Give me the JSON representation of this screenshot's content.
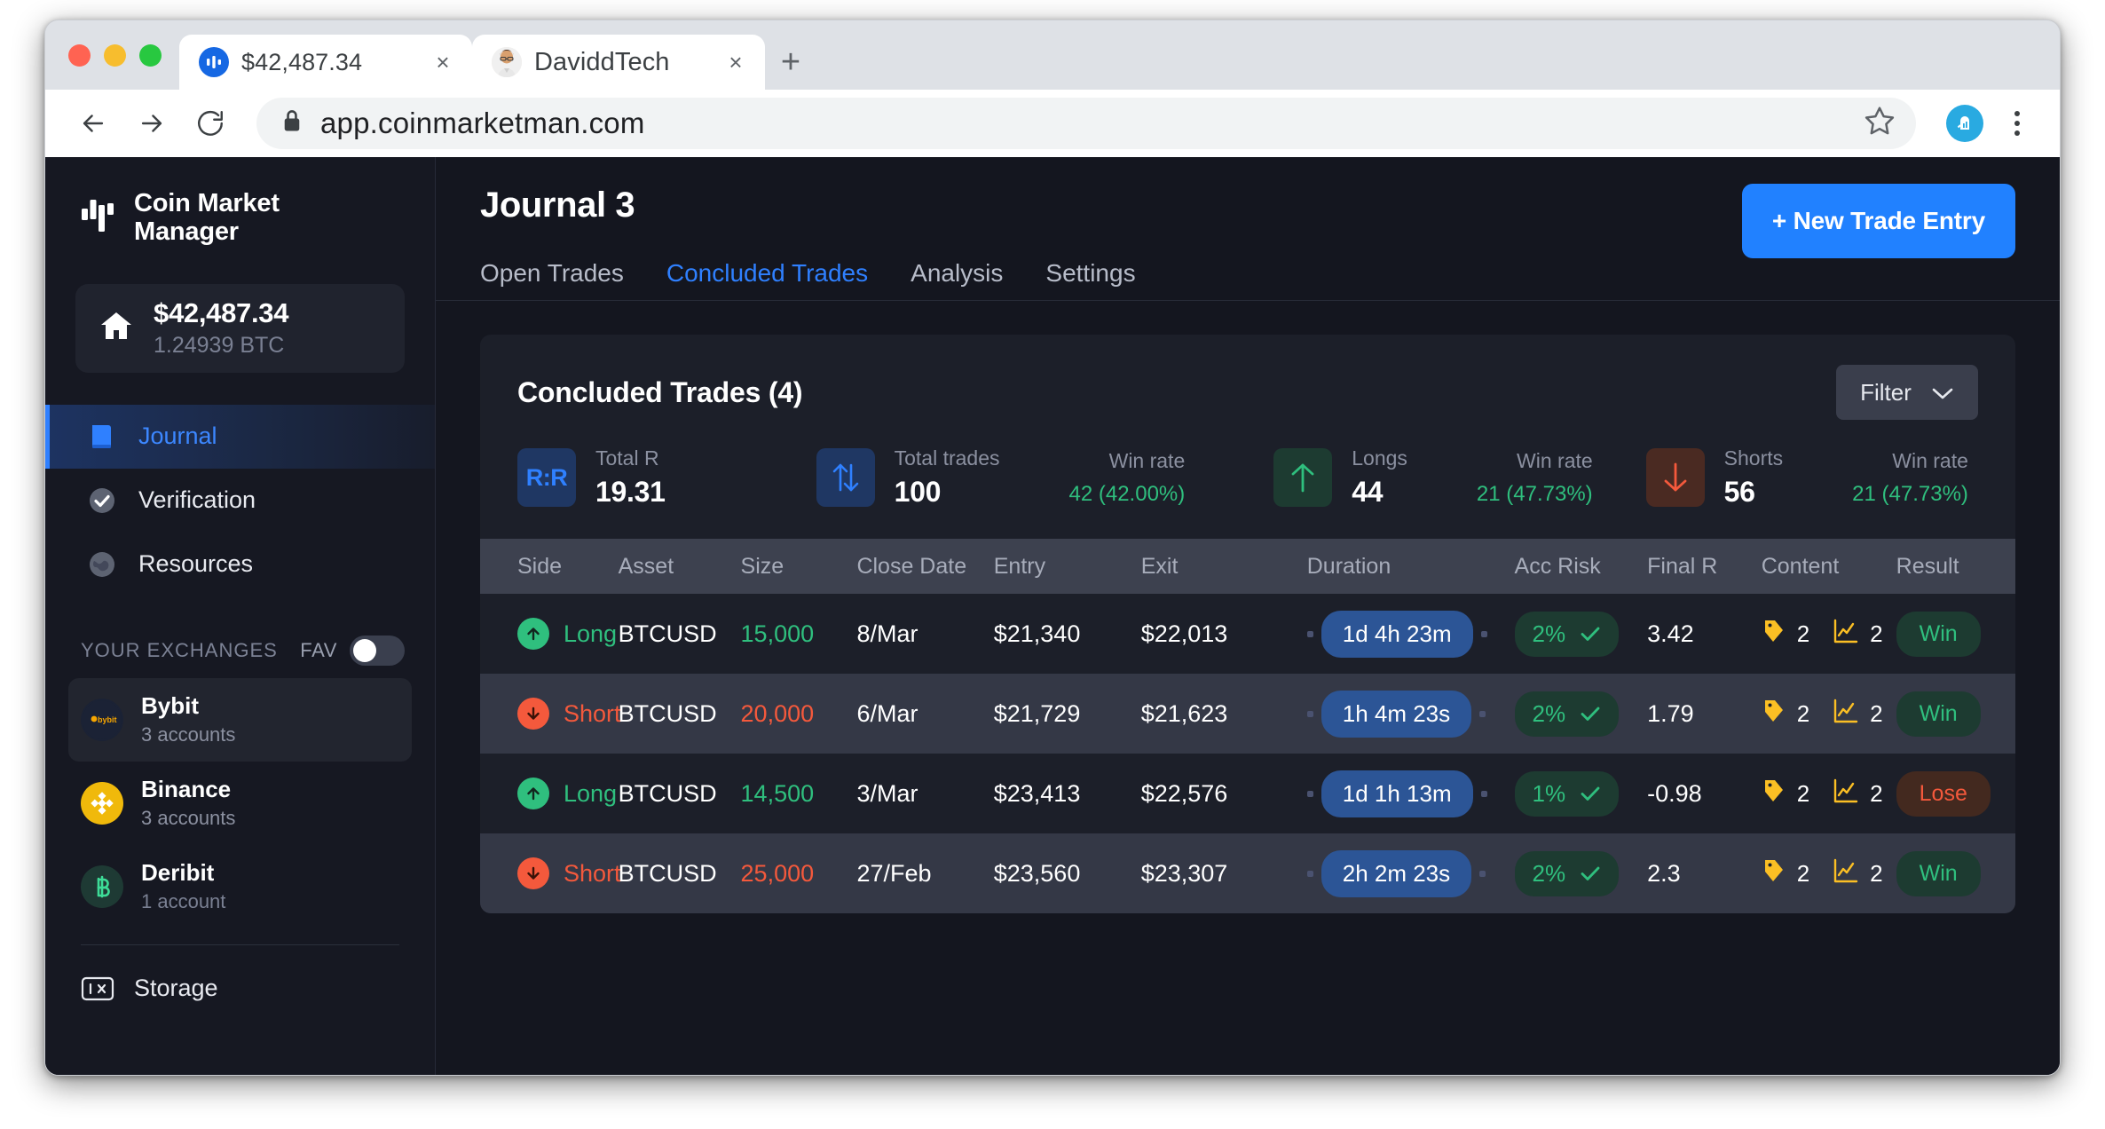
{
  "browser": {
    "tabs": [
      {
        "title": "$42,487.34",
        "favicon": "coinmarketmanager-icon",
        "active": false
      },
      {
        "title": "DaviddTech",
        "favicon": "avatar-icon",
        "active": true
      }
    ],
    "new_tab_label": "+",
    "close_label": "×",
    "url": "app.coinmarketman.com",
    "lock_icon": "lock-icon",
    "star_icon": "bookmark-star-icon",
    "extension_icon": "extension-icon",
    "menu_icon": "kebab-menu-icon",
    "back_icon": "back-arrow-icon",
    "forward_icon": "forward-arrow-icon",
    "reload_icon": "reload-icon"
  },
  "sidebar": {
    "logo": {
      "line1": "Coin Market",
      "line2": "Manager",
      "icon": "candlestick-logo-icon"
    },
    "balance": {
      "icon": "home-icon",
      "amount": "$42,487.34",
      "btc": "1.24939 BTC"
    },
    "nav": [
      {
        "label": "Journal",
        "icon": "book-icon",
        "active": true
      },
      {
        "label": "Verification",
        "icon": "check-circle-icon",
        "active": false
      },
      {
        "label": "Resources",
        "icon": "globe-icon",
        "active": false
      }
    ],
    "exchanges_header": {
      "label": "YOUR EXCHANGES",
      "fav_label": "FAV",
      "toggle_on": false
    },
    "exchanges": [
      {
        "name": "Bybit",
        "accounts": "3 accounts",
        "icon": "bybit-icon",
        "selected": true
      },
      {
        "name": "Binance",
        "accounts": "3 accounts",
        "icon": "binance-icon",
        "selected": false
      },
      {
        "name": "Deribit",
        "accounts": "1 account",
        "icon": "deribit-icon",
        "selected": false
      }
    ],
    "storage": {
      "label": "Storage",
      "icon": "storage-icon"
    }
  },
  "main": {
    "page_title": "Journal 3",
    "tabs": [
      {
        "label": "Open Trades",
        "active": false
      },
      {
        "label": "Concluded Trades",
        "active": true
      },
      {
        "label": "Analysis",
        "active": false
      },
      {
        "label": "Settings",
        "active": false
      }
    ],
    "new_trade_button": "+ New Trade Entry",
    "card_title": "Concluded Trades (4)",
    "filter_button": {
      "label": "Filter",
      "icon": "chevron-down-icon"
    },
    "stats": [
      {
        "icon": "rr-icon",
        "icon_text": "R:R",
        "label": "Total R",
        "value": "19.31",
        "winrate_label": null,
        "winrate_value": null
      },
      {
        "icon": "arrows-up-down-icon",
        "icon_text": "",
        "label": "Total trades",
        "value": "100",
        "winrate_label": "Win rate",
        "winrate_value": "42 (42.00%)"
      },
      {
        "icon": "arrow-up-icon",
        "icon_text": "",
        "label": "Longs",
        "value": "44",
        "winrate_label": "Win rate",
        "winrate_value": "21 (47.73%)"
      },
      {
        "icon": "arrow-down-icon",
        "icon_text": "",
        "label": "Shorts",
        "value": "56",
        "winrate_label": "Win rate",
        "winrate_value": "21 (47.73%)"
      }
    ],
    "table": {
      "columns": [
        "Side",
        "Asset",
        "Size",
        "Close Date",
        "Entry",
        "Exit",
        "Duration",
        "Acc Risk",
        "Final R",
        "Content",
        "Result"
      ],
      "rows": [
        {
          "side": "Long",
          "asset": "BTCUSD",
          "size": "15,000",
          "close_date": "8/Mar",
          "entry": "$21,340",
          "exit": "$22,013",
          "duration": "1d 4h 23m",
          "acc_risk": "2%",
          "final_r": "3.42",
          "tags": "2",
          "charts": "2",
          "result": "Win"
        },
        {
          "side": "Short",
          "asset": "BTCUSD",
          "size": "20,000",
          "close_date": "6/Mar",
          "entry": "$21,729",
          "exit": "$21,623",
          "duration": "1h 4m 23s",
          "acc_risk": "2%",
          "final_r": "1.79",
          "tags": "2",
          "charts": "2",
          "result": "Win"
        },
        {
          "side": "Long",
          "asset": "BTCUSD",
          "size": "14,500",
          "close_date": "3/Mar",
          "entry": "$23,413",
          "exit": "$22,576",
          "duration": "1d 1h 13m",
          "acc_risk": "1%",
          "final_r": "-0.98",
          "tags": "2",
          "charts": "2",
          "result": "Lose"
        },
        {
          "side": "Short",
          "asset": "BTCUSD",
          "size": "25,000",
          "close_date": "27/Feb",
          "entry": "$23,560",
          "exit": "$23,307",
          "duration": "2h 2m 23s",
          "acc_risk": "2%",
          "final_r": "2.3",
          "tags": "2",
          "charts": "2",
          "result": "Win"
        }
      ]
    }
  },
  "colors": {
    "accent_blue": "#2181ff",
    "green": "#2fbf7e",
    "red": "#f4593c",
    "yellow": "#fbbf24",
    "bg_dark": "#14161f",
    "card_bg": "#1c1f29"
  }
}
